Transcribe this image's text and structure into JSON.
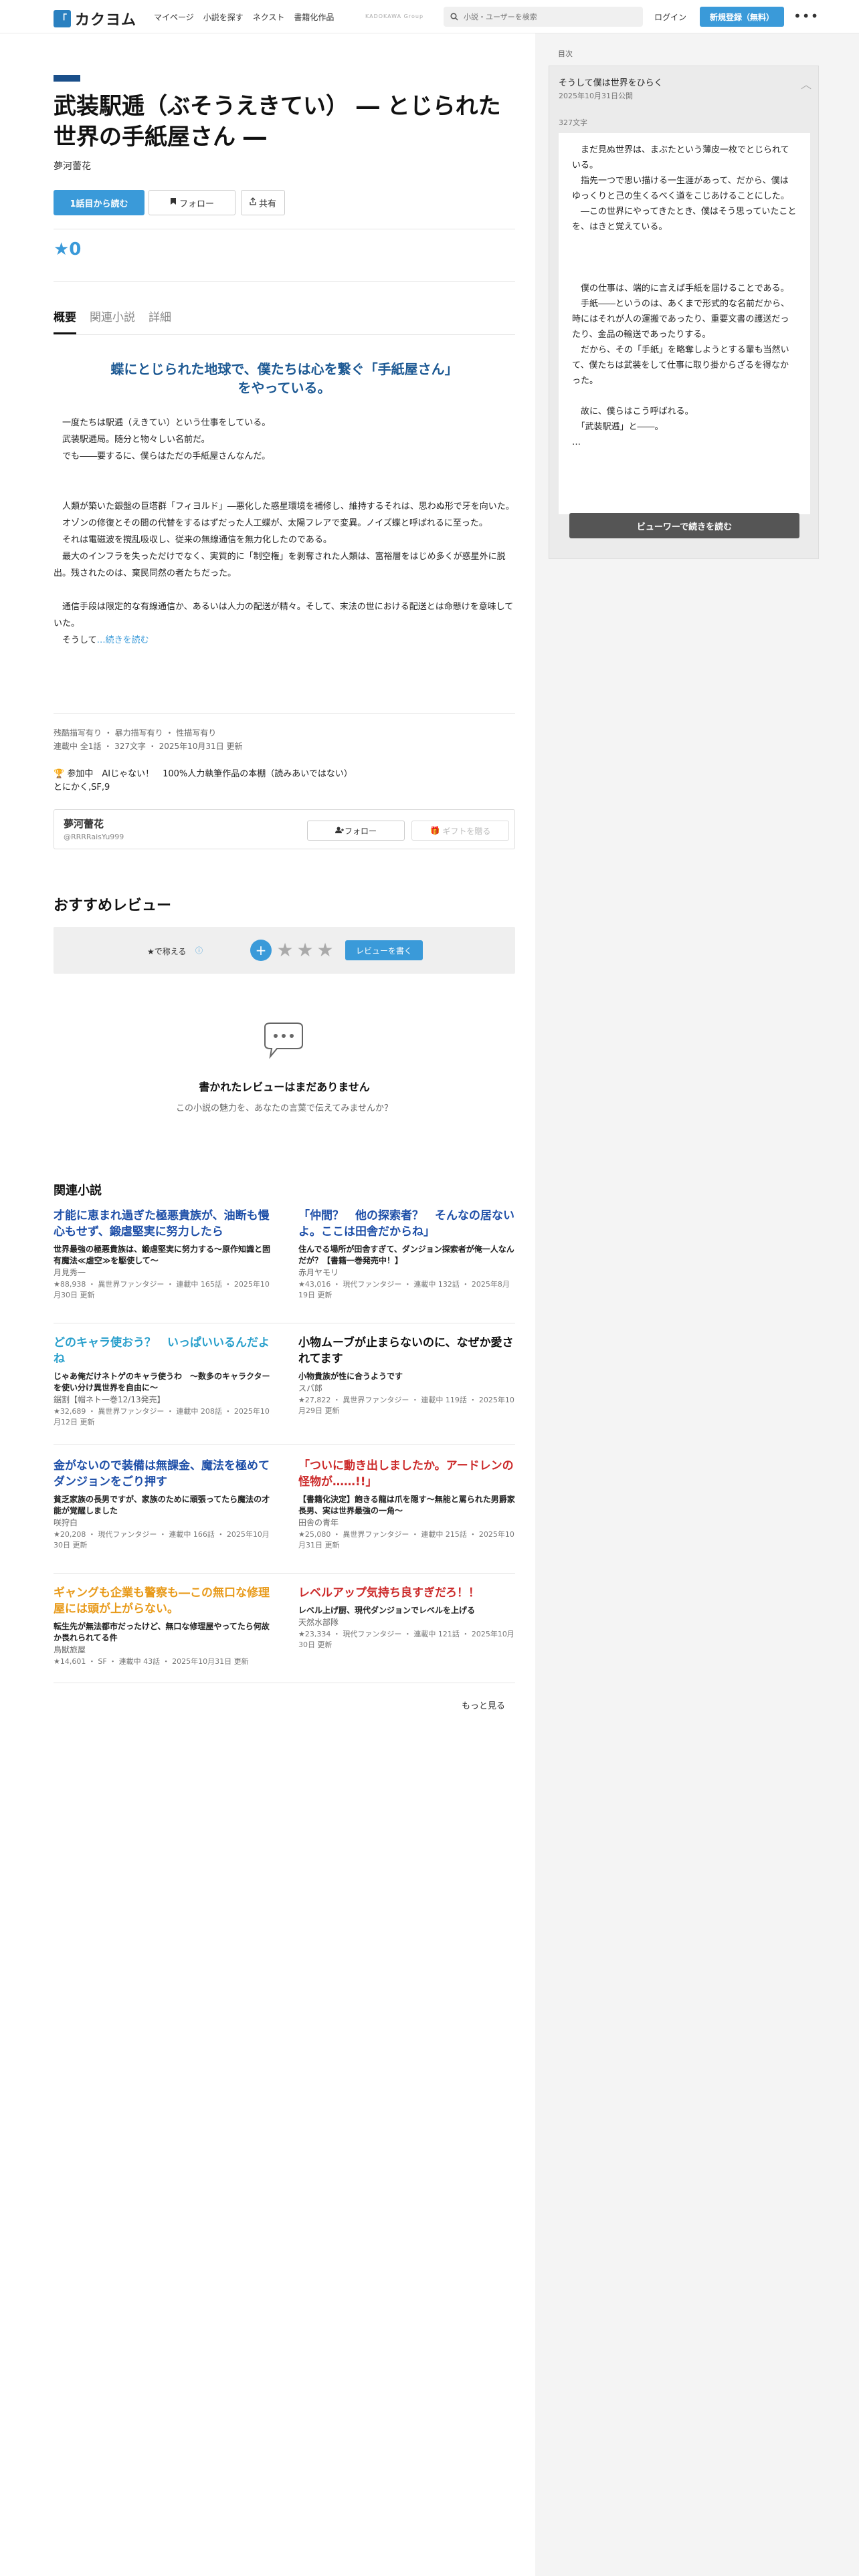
{
  "header": {
    "logo_text": "カクヨム",
    "nav": [
      "マイページ",
      "小説を探す",
      "ネクスト",
      "書籍化作品"
    ],
    "group_label": "KADOKAWA Group",
    "search_placeholder": "小説・ユーザーを検索",
    "login": "ログイン",
    "signup": "新規登録（無料）",
    "more": "•••"
  },
  "work": {
    "title": "武装駅逓（ぶそうえきてい） ― とじられた世界の手紙屋さん ―",
    "author": "夢河蕾花",
    "read_btn": "1話目から読む",
    "follow_btn": "フォロー",
    "share_btn": "共有",
    "stars": "★0",
    "tabs": [
      "概要",
      "関連小説",
      "詳細"
    ],
    "catchphrase": "蝶にとじられた地球で、僕たちは心を繋ぐ「手紙屋さん」をやっている。",
    "intro": "　一度たちは駅逓（えきてい）という仕事をしている。\n　武装駅逓局。随分と物々しい名前だ。\n　でも――要するに、僕らはただの手紙屋さんなんだ。\n\n\n　人類が築いた銀盤の巨塔群「フィヨルド」―悪化した惑星環境を補修し、維持するそれは、思わぬ形で牙を向いた。\n　オゾンの修復とその間の代替をするはずだった人工蝶が、太陽フレアで変異。ノイズ蝶と呼ばれるに至った。\n　それは電磁波を撹乱吸収し、従来の無線通信を無力化したのである。\n　最大のインフラを失っただけでなく、実質的に「制空権」を剥奪された人類は、富裕層をはじめ多くが惑星外に脱出。残されたのは、棄民同然の者たちだった。\n\n　通信手段は限定的な有線通信か、あるいは人力の配送が精々。そして、末法の世における配送とは命懸けを意味していた。\n　そうして",
    "intro_more": "…続きを読む",
    "tags": "残酷描写有り ・ 暴力描写有り ・ 性描写有り",
    "status": "連載中 全1話 ・ 327文字 ・ 2025年10月31日 更新",
    "contest_label": "参加中",
    "contest": "AIじゃない！　100%人力執筆作品の本棚（読みあいではない）\nとにかく,SF,9",
    "author_box": {
      "name": "夢河蕾花",
      "id": "@RRRRaisYu999",
      "follow": "フォロー",
      "gift": "ギフトを贈る"
    }
  },
  "reviews": {
    "title": "おすすめレビュー",
    "rate_label": "★で称える",
    "write_btn": "レビューを書く",
    "empty_title": "書かれたレビューはまだありません",
    "empty_sub": "この小説の魅力を、あなたの言葉で伝えてみませんか？"
  },
  "related": {
    "title": "関連小説",
    "more": "もっと見る",
    "items": [
      {
        "title": "才能に恵まれ過ぎた極悪貴族が、油断も慢心もせず、鍛虐堅実に努力したら",
        "color": "#1e4fa8",
        "sub": "世界最強の極悪貴族は、鍛虐堅実に努力する〜原作知識と固有魔法≪虐空≫を駆使して〜",
        "author": "月見秀一",
        "meta": "★88,938 ・ 異世界ファンタジー ・ 連載中 165話 ・ 2025年10月30日 更新"
      },
      {
        "title": "「仲間？　他の探索者？　そんなの居ないよ。ここは田舎だからね」",
        "color": "#1e4fa8",
        "sub": "住んでる場所が田舎すぎて、ダンジョン探索者が俺一人なんだが？【書籍一巻発売中！】",
        "author": "赤月ヤモリ",
        "meta": "★43,016 ・ 現代ファンタジー ・ 連載中 132話 ・ 2025年8月19日 更新"
      },
      {
        "title": "どのキャラ使おう？　いっぱいいるんだよね",
        "color": "#2aa0cc",
        "sub": "じゃあ俺だけネトゲのキャラ使うわ　〜数多のキャラクターを使い分け異世界を自由に〜",
        "author": "鋸割【帽ネト一巻12/13発売】",
        "meta": "★32,689 ・ 異世界ファンタジー ・ 連載中 208話 ・ 2025年10月12日 更新"
      },
      {
        "title": "小物ムーブが止まらないのに、なぜか愛されてます",
        "color": "#111111",
        "sub": "小物貴族が性に合うようです",
        "author": "スパ郎",
        "meta": "★27,822 ・ 異世界ファンタジー ・ 連載中 119話 ・ 2025年10月29日 更新"
      },
      {
        "title": "金がないので装備は無課金、魔法を極めてダンジョンをごり押す",
        "color": "#1e4fa8",
        "sub": "貧乏家族の長男ですが、家族のために頑張ってたら魔法の才能が覚醒しました",
        "author": "咲狩白",
        "meta": "★20,208 ・ 現代ファンタジー ・ 連載中 166話 ・ 2025年10月30日 更新"
      },
      {
        "title": "「ついに動き出しましたか。アードレンの怪物が……!!」",
        "color": "#cc2a2a",
        "sub": "【書籍化決定】飽きる龍は爪を隠す〜無能と罵られた男爵家長男、実は世界最強の一角〜",
        "author": "田舎の青年",
        "meta": "★25,080 ・ 異世界ファンタジー ・ 連載中 215話 ・ 2025年10月31日 更新"
      },
      {
        "title": "ギャングも企業も警察も―この無口な修理屋には頭が上がらない。",
        "color": "#e89a1a",
        "sub": "転生先が無法都市だったけど、無口な修理屋やってたら何故か畏れられてる件",
        "author": "鳥獣旅屋",
        "meta": "★14,601 ・ SF ・ 連載中 43話 ・ 2025年10月31日 更新"
      },
      {
        "title": "レベルアップ気持ち良すぎだろ！！",
        "color": "#cc2a2a",
        "sub": "レベル上げ厨、現代ダンジョンでレベルを上げる",
        "author": "天然水部隊",
        "meta": "★23,334 ・ 現代ファンタジー ・ 連載中 121話 ・ 2025年10月30日 更新"
      }
    ]
  },
  "side": {
    "toc_label": "目次",
    "chapter": "そうして僕は世界をひらく",
    "chapter_date": "2025年10月31日公開",
    "char_count": "327文字",
    "body": "　まだ見ぬ世界は、まぶたという薄皮一枚でとじられている。\n　指先一つで思い描ける一生涯があって、だから、僕はゆっくりと己の生くるべく道をこじあけることにした。\n　―この世界にやってきたとき、僕はそう思っていたことを、はきと覚えている。\n\n\n\n　僕の仕事は、端的に言えば手紙を届けることである。\n　手紙――というのは、あくまで形式的な名前だから、時にはそれが人の運搬であったり、重要文書の護送だったり、金品の輸送であったりする。\n　だから、その「手紙」を略奪しようとする輩も当然いて、僕たちは武装をして仕事に取り掛からざるを得なかった。\n\n　故に、僕らはこう呼ばれる。\n　「武装駅逓」と――。\n…",
    "viewer_btn": "ビューワーで続きを読む"
  }
}
